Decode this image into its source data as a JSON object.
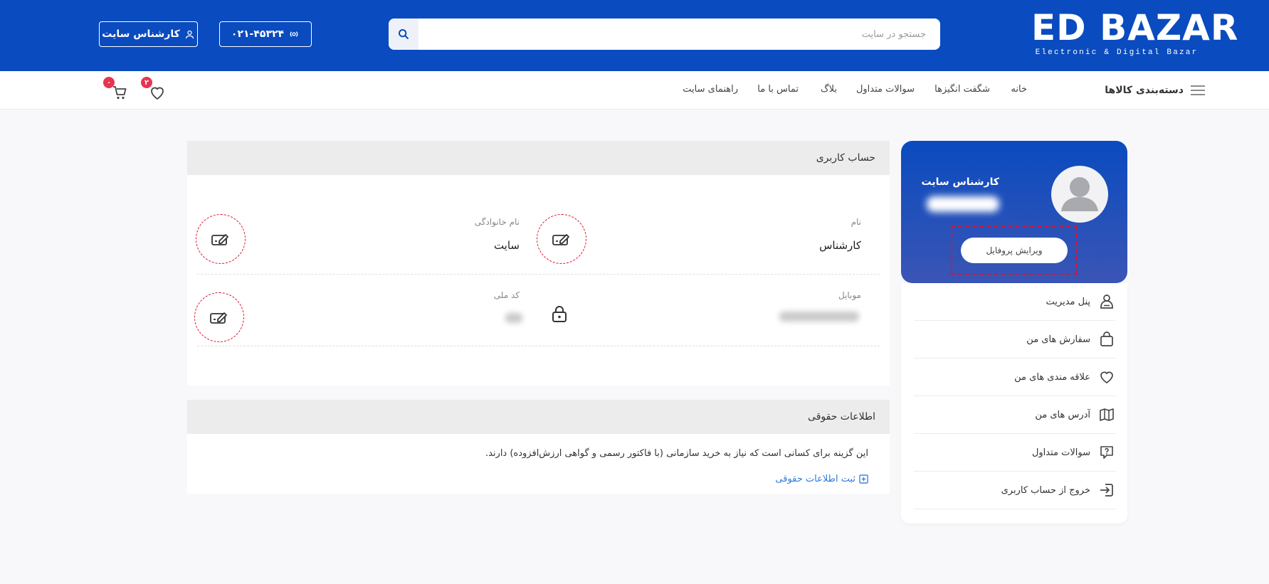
{
  "brand": {
    "name": "ED BAZAR",
    "tagline": "Electronic & Digital Bazar"
  },
  "header": {
    "search_placeholder": "جستجو در سایت",
    "phone": "۰۲۱-۴۵۳۲۴",
    "user_label": "کارشناس سایت"
  },
  "nav": {
    "categories_label": "دسته‌بندی کالاها",
    "links": [
      "خانه",
      "شگفت انگیزها",
      "سوالات متداول",
      "بلاگ",
      "تماس با ما",
      "راهنمای سایت"
    ],
    "wishlist_count": "۲",
    "cart_count": "۰"
  },
  "profile": {
    "name": "کارشناس سایت",
    "edit_label": "ویرایش پروفایل"
  },
  "sidebar": {
    "items": [
      {
        "label": "پنل مدیریت",
        "icon": "admin-user-icon"
      },
      {
        "label": "سفارش های من",
        "icon": "shopping-bag-icon"
      },
      {
        "label": "علاقه مندی های من",
        "icon": "heart-icon"
      },
      {
        "label": "آدرس های من",
        "icon": "map-icon"
      },
      {
        "label": "سوالات متداول",
        "icon": "question-icon"
      },
      {
        "label": "خروج از حساب کاربری",
        "icon": "logout-icon"
      }
    ]
  },
  "account": {
    "title": "حساب کاربری",
    "first_name_label": "نام",
    "first_name": "کارشناس",
    "last_name_label": "نام خانوادگی",
    "last_name": "سایت",
    "mobile_label": "موبایل",
    "national_code_label": "کد ملی"
  },
  "legal": {
    "title": "اطلاعات حقوقی",
    "description": "این گزینه برای کسانی است که نیاز به خرید سازمانی (با فاکتور رسمی و گواهی ارزش‌افزوده) دارند.",
    "link_label": "ثبت اطلاعات حقوقی"
  },
  "colors": {
    "primary": "#0a4bbf",
    "accent": "#e0112c",
    "link": "#2f7bd8"
  }
}
